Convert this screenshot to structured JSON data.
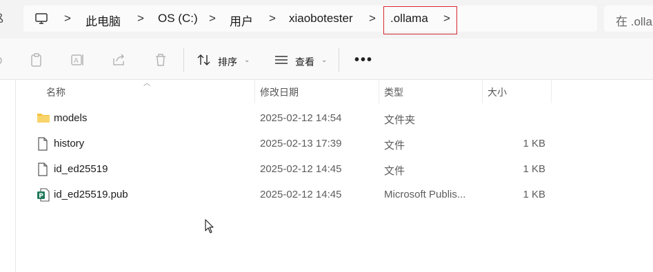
{
  "address": {
    "left_edge_char": "ß",
    "crumbs": [
      {
        "label": "此电脑"
      },
      {
        "label": "OS (C:)"
      },
      {
        "label": "用户"
      },
      {
        "label": "xiaobotester"
      },
      {
        "label": ".ollama"
      }
    ],
    "separator": ">",
    "search_text": "在 .olla"
  },
  "toolbar": {
    "sort_label": "排序",
    "view_label": "查看",
    "more_label": "•••"
  },
  "columns": {
    "name": "名称",
    "modified": "修改日期",
    "type": "类型",
    "size": "大小"
  },
  "files": [
    {
      "name": "models",
      "modified": "2025-02-12 14:54",
      "type": "文件夹",
      "size": "",
      "icon": "folder-icon"
    },
    {
      "name": "history",
      "modified": "2025-02-13 17:39",
      "type": "文件",
      "size": "1 KB",
      "icon": "file-icon"
    },
    {
      "name": "id_ed25519",
      "modified": "2025-02-12 14:45",
      "type": "文件",
      "size": "1 KB",
      "icon": "file-icon"
    },
    {
      "name": "id_ed25519.pub",
      "modified": "2025-02-12 14:45",
      "type": "Microsoft Publis...",
      "size": "1 KB",
      "icon": "publisher-icon"
    }
  ],
  "colors": {
    "highlight_border": "#d6262f",
    "folder_yellow": "#f4c23d",
    "publisher_green": "#1f7a5c"
  }
}
